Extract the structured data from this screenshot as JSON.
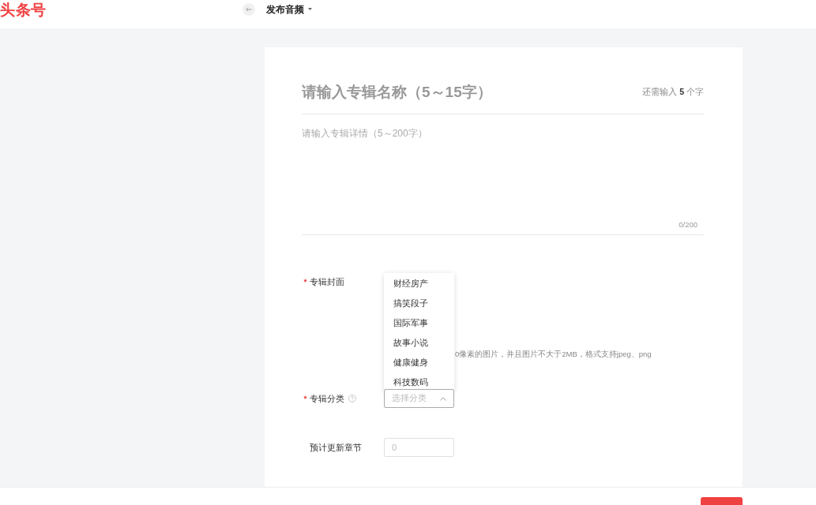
{
  "header": {
    "logo": "头条号",
    "page_title": "发布音频"
  },
  "album": {
    "name_placeholder": "请输入专辑名称（5～15字）",
    "remaining": "还需输入 **5** 个字",
    "details_placeholder": "请输入专辑详情（5～200字）",
    "details_counter": "0/200"
  },
  "fields": [
    {
      "kind": "cover",
      "label": "专辑封面",
      "required": true,
      "hint": "0像素的图片，并且图片不大于2MB，格式支持jpeg、png"
    },
    {
      "kind": "select",
      "label": "专辑分类",
      "required": true,
      "help": true,
      "placeholder": "选择分类",
      "expanded": true,
      "options": [
        "财经房产",
        "搞笑段子",
        "国际军事",
        "故事小说",
        "健康健身",
        "科技数码"
      ]
    },
    {
      "kind": "number",
      "label": "预计更新章节",
      "required": false,
      "placeholder": "0"
    }
  ]
}
